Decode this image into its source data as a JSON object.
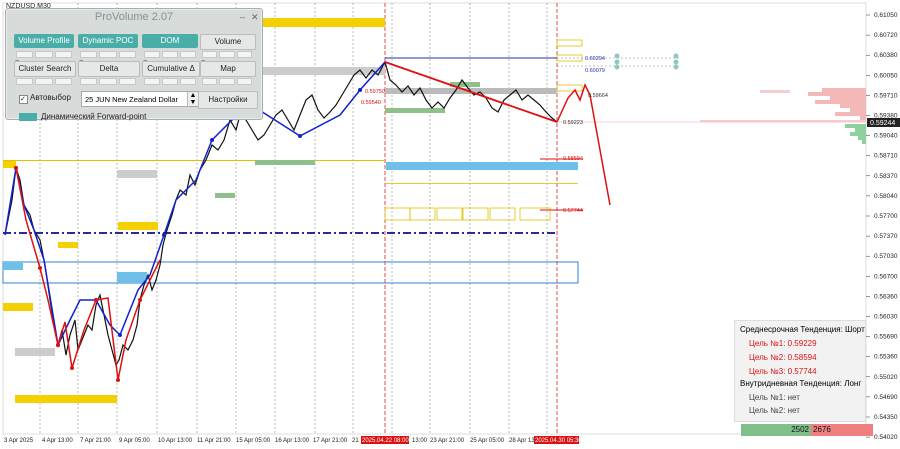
{
  "symbol": "NZDUSD,M30",
  "panel": {
    "title": "ProVolume 2.07",
    "buttons": [
      "Volume Profile",
      "Dynamic POC",
      "DOM",
      "Volume",
      "Cluster Search",
      "Delta",
      "Cumulative Δ",
      "Map"
    ],
    "autoselect_label": "Автовыбор",
    "instrument_value": "25 JUN New Zealand Dollar",
    "settings_label": "Настройки",
    "forward_point_label": "Динамический Forward-point"
  },
  "price_axis": [
    "0.61050",
    "0.60720",
    "0.60380",
    "0.60050",
    "0.59710",
    "0.59380",
    "0.59040",
    "0.58710",
    "0.58370",
    "0.58040",
    "0.57700",
    "0.57370",
    "0.57030",
    "0.56700",
    "0.56360",
    "0.56030",
    "0.55690",
    "0.55360",
    "0.55020",
    "0.54690",
    "0.54350",
    "0.54020"
  ],
  "current_price": "0.59244",
  "time_axis": [
    "3 Apr 2025",
    "4 Apr 13:00",
    "7 Apr 21:00",
    "9 Apr 05:00",
    "10 Apr 13:00",
    "11 Apr 21:00",
    "15 Apr 05:00",
    "16 Apr 13:00",
    "17 Apr 21:00",
    "21",
    "2025.04.22 08:00",
    "13:00",
    "23 Apr 21:00",
    "25 Apr 05:00",
    "28 Apr 13:00",
    "2025.04.30 05:30"
  ],
  "level_labels": [
    "0.60294",
    "0.60079",
    "0.59664",
    "0.59223",
    "0.58594",
    "0.57744",
    "0.59750",
    "0.59540"
  ],
  "trend_info": {
    "medium_title": "Среднесрочная Тенденция: Шорт",
    "medium_targets": [
      "Цель №1: 0.59229",
      "Цель №2: 0.58594",
      "Цель №3: 0.57744"
    ],
    "intraday_title": "Внутридневная Тенденция: Лонг",
    "intraday_targets": [
      "Цель №1: нет",
      "Цель №2: нет"
    ]
  },
  "volume_bar": {
    "buy": "2502",
    "sell": "2676"
  },
  "colors": {
    "zigzag_red": "#dd1111",
    "zigzag_blue": "#1122cc",
    "teal": "#4aaea8",
    "yellow": "#f5d000",
    "blue_zone": "#6ec0e8",
    "poc_gray": "#808080"
  }
}
